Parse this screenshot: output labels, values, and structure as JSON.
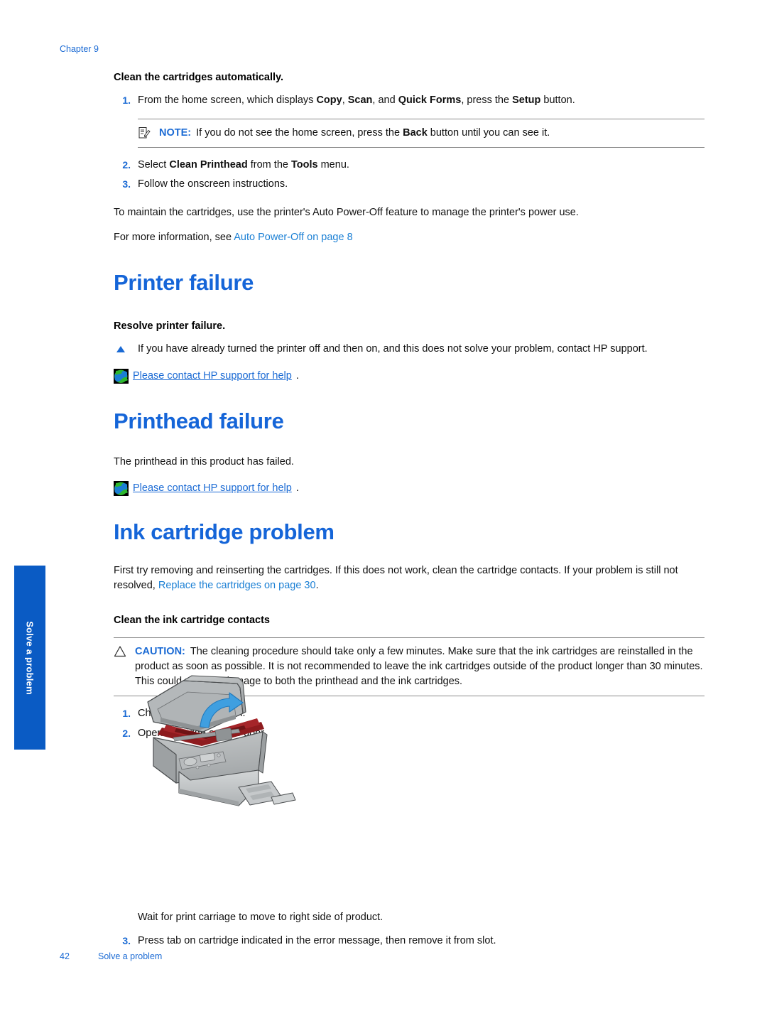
{
  "chapter_label": "Chapter 9",
  "side_tab": {
    "label": "Solve a problem"
  },
  "sections": {
    "clean_auto": {
      "heading": "Clean the cartridges automatically.",
      "step1_pre": "From the home screen, which displays ",
      "step1_b1": "Copy",
      "step1_mid1": ", ",
      "step1_b2": "Scan",
      "step1_mid2": ", and ",
      "step1_b3": "Quick Forms",
      "step1_mid3": ", press the ",
      "step1_b4": "Setup",
      "step1_post": " button.",
      "note_label": "NOTE:",
      "note_pre": "If you do not see the home screen, press the ",
      "note_b": "Back",
      "note_post": " button until you can see it.",
      "step2_pre": "Select ",
      "step2_b1": "Clean Printhead",
      "step2_mid": " from the ",
      "step2_b2": "Tools",
      "step2_post": " menu.",
      "step3": "Follow the onscreen instructions.",
      "para_maintain": "To maintain the cartridges, use the printer's Auto Power-Off feature to manage the printer's power use.",
      "para_more_pre": "For more information, see ",
      "para_more_link": "Auto Power-Off on page 8"
    },
    "printer_failure": {
      "title": "Printer failure",
      "sub_head": "Resolve printer failure.",
      "bullet": "If you have already turned the printer off and then on, and this does not solve your problem, contact HP support.",
      "support_link": "Please contact HP support for help",
      "support_suffix": "."
    },
    "printhead_failure": {
      "title": "Printhead failure",
      "para": "The printhead in this product has failed.",
      "support_link": "Please contact HP support for help",
      "support_suffix": "."
    },
    "ink_cartridge_problem": {
      "title": "Ink cartridge problem",
      "para_pre": "First try removing and reinserting the cartridges. If this does not work, clean the cartridge contacts. If your problem is still not resolved, ",
      "para_link": "Replace the cartridges on page 30",
      "para_post": ".",
      "sub_head": "Clean the ink cartridge contacts",
      "caution_label": "CAUTION:",
      "caution_text": "The cleaning procedure should take only a few minutes. Make sure that the ink cartridges are reinstalled in the product as soon as possible. It is not recommended to leave the ink cartridges outside of the product longer than 30 minutes. This could result in damage to both the printhead and the ink cartridges.",
      "step1": "Check that power is on.",
      "step2": "Open cartridge access door.",
      "figure_caption": "Wait for print carriage to move to right side of product.",
      "step3": "Press tab on cartridge indicated in the error message, then remove it from slot."
    }
  },
  "numbers": {
    "one": "1.",
    "two": "2.",
    "three": "3."
  },
  "footer": {
    "page_number": "42",
    "section_name": "Solve a problem"
  },
  "colors": {
    "heading_blue": "#1565d8",
    "link_blue": "#1a7fd4",
    "tab_blue": "#0a5bc4",
    "accent_blue": "#1a6ad4",
    "printer_body": "#b9bcbd",
    "printer_interior_red": "#9e1f22",
    "arrow_blue": "#3f9fe0"
  }
}
